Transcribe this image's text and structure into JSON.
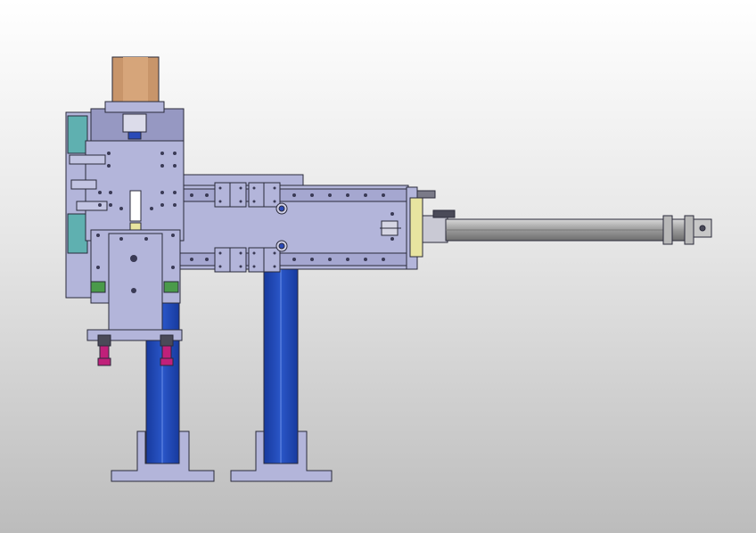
{
  "view": {
    "type": "cad-assembly-front-view",
    "background_gradient": [
      "#ffffff",
      "#e6e6e6",
      "#bcbcbc"
    ]
  },
  "colors": {
    "plate": "#b3b5da",
    "plate_dark": "#9698c2",
    "outline": "#2a2a3a",
    "motor": "#c8956a",
    "column_blue": "#1e46b8",
    "column_light": "#4a72d8",
    "teal": "#5fb0b0",
    "magenta": "#c0207a",
    "yellow": "#e8e4a0",
    "rod": "#a8a8a8",
    "green": "#4a9a4a"
  },
  "icons": [
    "motor-icon",
    "vacuum-cup-icon",
    "cylinder-icon",
    "linear-bearing-icon"
  ]
}
